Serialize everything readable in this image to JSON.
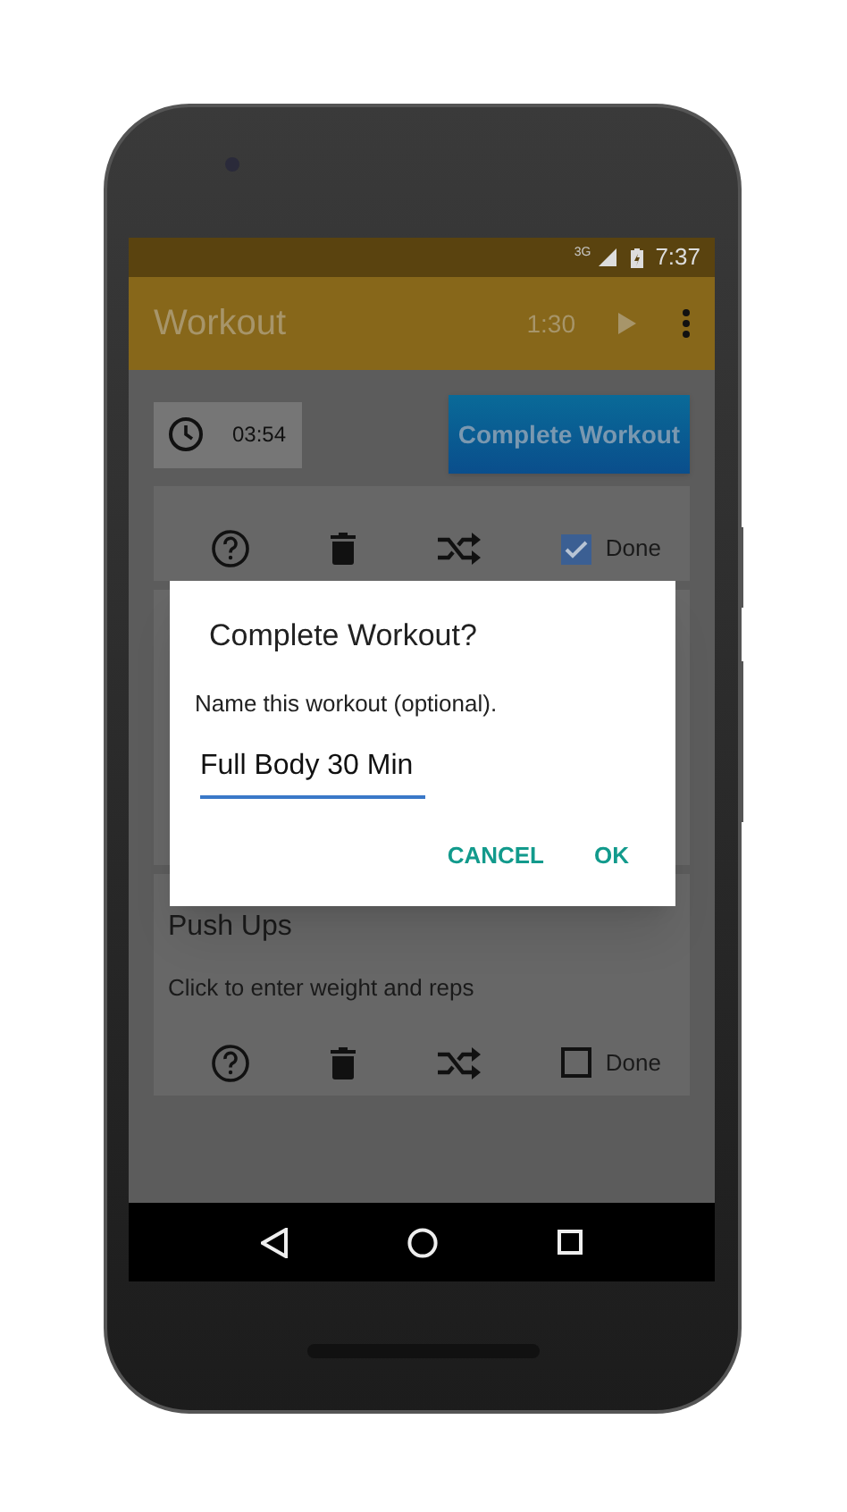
{
  "status_bar": {
    "network": "3G",
    "time": "7:37"
  },
  "app_bar": {
    "title": "Workout",
    "timer": "1:30"
  },
  "timer_chip": {
    "time": "03:54"
  },
  "complete_button": {
    "label": "Complete Workout"
  },
  "exercises": [
    {
      "done": true,
      "done_label": "Done"
    },
    {
      "name": "Push Ups",
      "hint": "Click to enter weight and reps",
      "done": false,
      "done_label": "Done"
    }
  ],
  "dialog": {
    "title": "Complete Workout?",
    "message": "Name this workout (optional).",
    "value": "Full Body 30 Min",
    "buttons": [
      "CANCEL",
      "OK"
    ]
  }
}
